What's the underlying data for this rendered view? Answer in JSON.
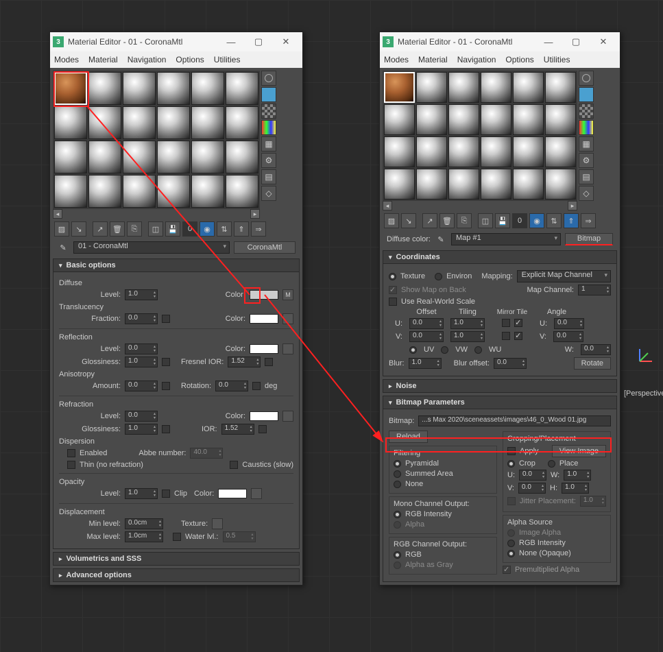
{
  "viewport_label": "[Perspective",
  "window_title": "Material Editor - 01 - CoronaMtl",
  "menu": [
    "Modes",
    "Material",
    "Navigation",
    "Options",
    "Utilities"
  ],
  "left": {
    "mat_name": "01 - CoronaMtl",
    "mat_type": "CoronaMtl",
    "rollouts": {
      "basic": "Basic options",
      "volumetrics": "Volumetrics and SSS",
      "advanced": "Advanced options"
    },
    "labels": {
      "diffuse": "Diffuse",
      "level": "Level:",
      "color": "Color:",
      "translucency": "Translucency",
      "fraction": "Fraction:",
      "reflection": "Reflection",
      "glossiness": "Glossiness:",
      "fresnel_ior": "Fresnel IOR:",
      "anisotropy": "Anisotropy",
      "amount": "Amount:",
      "rotation": "Rotation:",
      "deg": "deg",
      "refraction": "Refraction",
      "ior": "IOR:",
      "dispersion": "Dispersion",
      "enabled": "Enabled",
      "abbe": "Abbe number:",
      "thin": "Thin (no refraction)",
      "caustics": "Caustics (slow)",
      "opacity": "Opacity",
      "clip": "Clip",
      "displacement": "Displacement",
      "min_level": "Min level:",
      "max_level": "Max level:",
      "texture": "Texture:",
      "water_lvl": "Water lvl.:",
      "m_btn": "M"
    },
    "values": {
      "diffuse_level": "1.0",
      "trans_fraction": "0.0",
      "refl_level": "0.0",
      "refl_gloss": "1.0",
      "fresnel_ior": "1.52",
      "aniso_amount": "0.0",
      "aniso_rotation": "0.0",
      "refr_level": "0.0",
      "refr_gloss": "1.0",
      "ior": "1.52",
      "abbe": "40.0",
      "opacity_level": "1.0",
      "disp_min": "0.0cm",
      "disp_max": "1.0cm",
      "water_lvl": "0.5"
    }
  },
  "right": {
    "diffuse_color": "Diffuse color:",
    "map_name": "Map #1",
    "bitmap_btn": "Bitmap",
    "rollouts": {
      "coordinates": "Coordinates",
      "noise": "Noise",
      "bitmap_params": "Bitmap Parameters"
    },
    "coord": {
      "texture": "Texture",
      "environ": "Environ",
      "mapping": "Mapping:",
      "mapping_val": "Explicit Map Channel",
      "show_map": "Show Map on Back",
      "map_channel": "Map Channel:",
      "map_channel_val": "1",
      "real_world": "Use Real-World Scale",
      "offset": "Offset",
      "tiling": "Tiling",
      "mirror": "Mirror",
      "tile": "Tile",
      "angle": "Angle",
      "u": "U:",
      "v": "V:",
      "w": "W:",
      "uv": "UV",
      "vw": "VW",
      "wu": "WU",
      "blur": "Blur:",
      "blur_offset": "Blur offset:",
      "rotate": "Rotate",
      "u_offset": "0.0",
      "v_offset": "0.0",
      "u_tiling": "1.0",
      "v_tiling": "1.0",
      "u_angle": "0.0",
      "v_angle": "0.0",
      "w_angle": "0.0",
      "blur_val": "1.0",
      "blur_offset_val": "0.0"
    },
    "bp": {
      "bitmap_label": "Bitmap:",
      "bitmap_path": "...s Max 2020\\sceneassets\\images\\46_0_Wood 01.jpg",
      "reload": "Reload",
      "cropping": "Cropping/Placement",
      "apply": "Apply",
      "view_image": "View Image",
      "crop": "Crop",
      "place": "Place",
      "u": "U:",
      "v": "V:",
      "w": "W:",
      "h": "H:",
      "u_val": "0.0",
      "v_val": "0.0",
      "w_val": "1.0",
      "h_val": "1.0",
      "jitter": "Jitter Placement:",
      "jitter_val": "1.0",
      "filtering": "Filtering",
      "pyramidal": "Pyramidal",
      "summed": "Summed Area",
      "none": "None",
      "mono": "Mono Channel Output:",
      "rgb_intensity": "RGB Intensity",
      "alpha": "Alpha",
      "rgbch": "RGB Channel Output:",
      "rgb": "RGB",
      "alpha_gray": "Alpha as Gray",
      "alpha_source": "Alpha Source",
      "image_alpha": "Image Alpha",
      "none_opaque": "None (Opaque)",
      "premult": "Premultiplied Alpha"
    }
  }
}
